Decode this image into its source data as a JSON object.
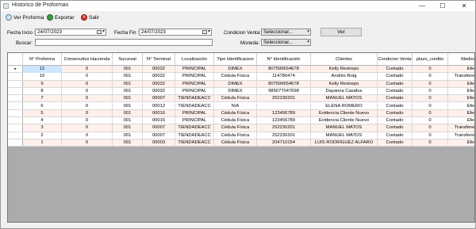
{
  "window": {
    "title": "Historico de Proformas",
    "controls": [
      "—",
      "☐",
      "✕"
    ]
  },
  "toolbar": {
    "view_label": "Ver Proforma",
    "export_label": "Exportar",
    "exit_label": "Salir"
  },
  "filters": {
    "date_start_label": "Fecha Incio :",
    "date_start_value": "24/07/2023",
    "date_end_label": "Fecha Fin :",
    "date_end_value": "24/07/2023",
    "condition_label": "Condicion Venta:",
    "condition_value": "Seleccionar...",
    "currency_label": "Moneda:",
    "currency_value": "Seleccionar...",
    "search_label": "Buscar:",
    "search_value": "",
    "view_button": "Ver"
  },
  "table": {
    "columns": [
      "N° Proforma",
      "Consecutivo Hacienda",
      "Sucursal",
      "N° Terminal",
      "Localización",
      "Tipo Identificacion",
      "N° Identificación",
      "Clientes",
      "Condicion Venta",
      "plazo_credito",
      "Medios de"
    ],
    "rows": [
      [
        "12",
        "0",
        "001",
        "00032",
        "PRINCIPAL",
        "DIMEX",
        "807599654678",
        "Kelly Restrepo",
        "Contado",
        "0",
        "Efec"
      ],
      [
        "10",
        "0",
        "001",
        "00032",
        "PRINCIPAL",
        "Cédula Física",
        "114780474",
        "Andrés Roig",
        "Contado",
        "0",
        "Transferencia - d"
      ],
      [
        "9",
        "0",
        "001",
        "00032",
        "PRINCIPAL",
        "DIMEX",
        "807599654678",
        "Kelly Restrepo",
        "Contado",
        "0",
        "Efec"
      ],
      [
        "8",
        "0",
        "001",
        "00032",
        "PRINCIPAL",
        "DIMEX",
        "985677047698",
        "Dayanna Casafus",
        "Contado",
        "0",
        "Efec"
      ],
      [
        "7",
        "0",
        "001",
        "00007",
        "TIENDADEACC",
        "Cédula Física",
        "252230201",
        "MANUEL MATOS",
        "Contado",
        "0",
        "Efec"
      ],
      [
        "6",
        "0",
        "001",
        "00012",
        "TIENDADEACC",
        "N/A",
        "",
        "ELENA ROMERO",
        "Contado",
        "0",
        "Efec"
      ],
      [
        "5",
        "0",
        "001",
        "00016",
        "PRINCIPAL",
        "Cédula Física",
        "123456789",
        "Evidencia Cliente Nuevo",
        "Contado",
        "0",
        "Efec"
      ],
      [
        "4",
        "0",
        "001",
        "00016",
        "PRINCIPAL",
        "Cédula Física",
        "123456789",
        "Evidencia Cliente Nuevo",
        "Contado",
        "0",
        "Efec"
      ],
      [
        "3",
        "0",
        "001",
        "00007",
        "TIENDADEACC",
        "Cédula Física",
        "252230201",
        "MANUEL MATOS",
        "Contado",
        "0",
        "Transferencia - d"
      ],
      [
        "2",
        "0",
        "001",
        "00007",
        "TIENDADEACC",
        "Cédula Física",
        "252230201",
        "MANUEL MATOS",
        "Contado",
        "0",
        "Transferencia - d"
      ],
      [
        "1",
        "0",
        "001",
        "00003",
        "TIENDADEACC",
        "Cédula Física",
        "204710154",
        "LUIS RODRIGUEZ ALFARO",
        "Contado",
        "0",
        "Efec"
      ]
    ],
    "selected_row_marker": "▸"
  },
  "colors": {
    "window_bg": "#f0f0f0",
    "grid_bg": "#ababab",
    "row_alt": "#fff0ec",
    "selection": "#cde6ff"
  }
}
